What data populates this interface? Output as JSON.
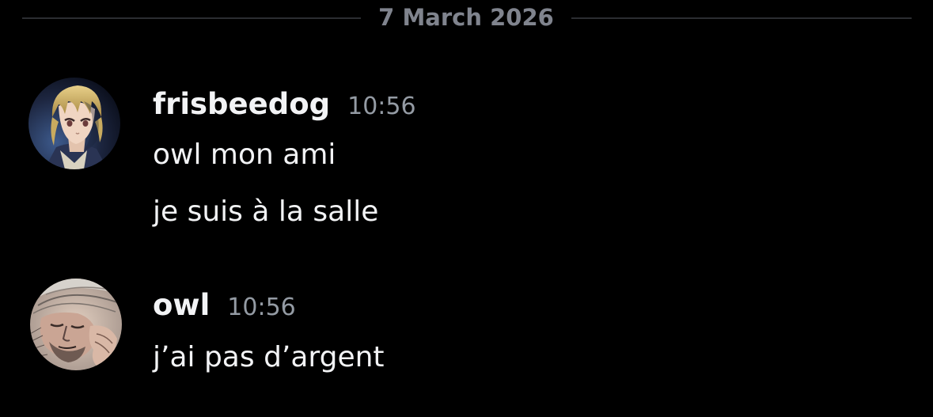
{
  "divider": {
    "date": "7 March 2026"
  },
  "messages": [
    {
      "username": "frisbeedog",
      "timestamp": "10:56",
      "avatar": "anime-blonde-character-avatar",
      "lines": [
        "owl mon ami",
        "je suis à la salle"
      ]
    },
    {
      "username": "owl",
      "timestamp": "10:56",
      "avatar": "sketched-face-avatar",
      "lines": [
        "j’ai pas d’argent"
      ]
    }
  ],
  "colors": {
    "background": "#000000",
    "text": "#f2f3f5",
    "muted": "#949ba4",
    "divider_line": "#2b2d31",
    "divider_text": "#80848e"
  }
}
